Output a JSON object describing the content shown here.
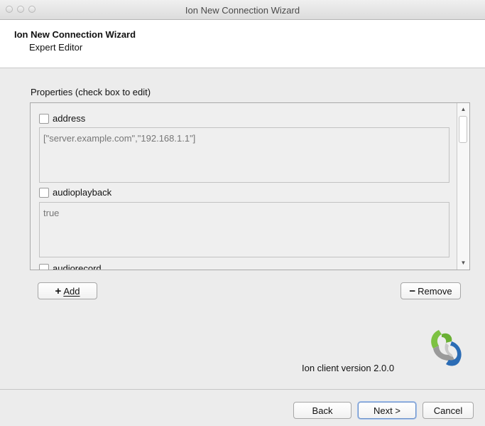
{
  "window": {
    "title": "Ion New Connection Wizard"
  },
  "header": {
    "title": "Ion New Connection Wizard",
    "subtitle": "Expert Editor"
  },
  "properties": {
    "label": "Properties (check box to edit)",
    "items": [
      {
        "name": "address",
        "checked": false,
        "value": "[\"server.example.com\",\"192.168.1.1\"]"
      },
      {
        "name": "audioplayback",
        "checked": false,
        "value": "true"
      },
      {
        "name": "audiorecord",
        "checked": false,
        "value": ""
      }
    ]
  },
  "buttons": {
    "add": "Add",
    "remove": "Remove",
    "back": "Back",
    "next": "Next >",
    "cancel": "Cancel"
  },
  "version_text": "Ion client version 2.0.0",
  "colors": {
    "logo_green": "#7dc242",
    "logo_blue": "#2b6cb5",
    "logo_gray": "#9a9a9a",
    "default_button_border": "#6a90c9"
  }
}
